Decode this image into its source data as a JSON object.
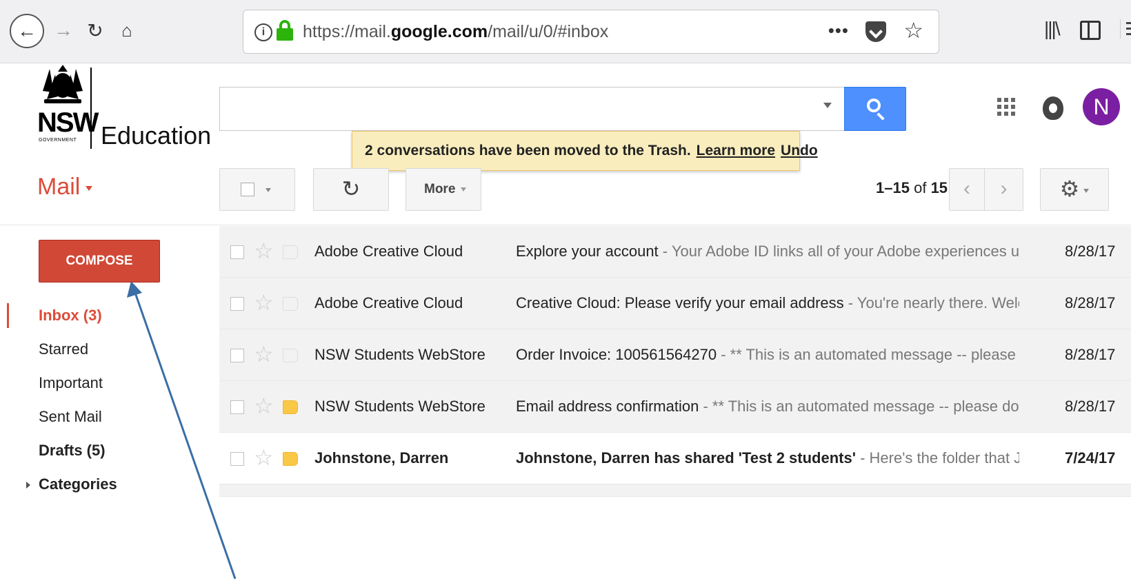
{
  "browser": {
    "url_prefix": "https://mail.",
    "url_domain": "google.com",
    "url_path": "/mail/u/0/#inbox",
    "url_more": "•••"
  },
  "brand": {
    "logo_word": "NSW",
    "logo_sub": "GOVERNMENT",
    "product": "Education"
  },
  "search": {
    "placeholder": ""
  },
  "account": {
    "initial": "N",
    "avatar_color": "#7b1fa2"
  },
  "toast": {
    "message": "2 conversations have been moved to the Trash.",
    "learn_more": "Learn more",
    "undo": "Undo"
  },
  "toolbar": {
    "mail_label": "Mail",
    "more_label": "More",
    "range": "1–15",
    "of_label": "of",
    "total": "15"
  },
  "compose_label": "COMPOSE",
  "nav": [
    {
      "label": "Inbox (3)",
      "state": "active"
    },
    {
      "label": "Starred",
      "state": ""
    },
    {
      "label": "Important",
      "state": ""
    },
    {
      "label": "Sent Mail",
      "state": ""
    },
    {
      "label": "Drafts (5)",
      "state": "bold"
    },
    {
      "label": "Categories",
      "state": "bold"
    }
  ],
  "emails": [
    {
      "sender": "Adobe Creative Cloud",
      "subject": "Explore your account",
      "snippet": " - Your Adobe ID links all of your Adobe experiences under one",
      "date": "8/28/17",
      "unread": false,
      "important": false
    },
    {
      "sender": "Adobe Creative Cloud",
      "subject": "Creative Cloud: Please verify your email address",
      "snippet": " - You're nearly there. Welcome to (",
      "date": "8/28/17",
      "unread": false,
      "important": false
    },
    {
      "sender": "NSW Students WebStore",
      "subject": "Order Invoice: 100561564270",
      "snippet": " - ** This is an automated message -- please do not re",
      "date": "8/28/17",
      "unread": false,
      "important": false
    },
    {
      "sender": "NSW Students WebStore",
      "subject": "Email address confirmation",
      "snippet": " - ** This is an automated message -- please do not reply",
      "date": "8/28/17",
      "unread": false,
      "important": true
    },
    {
      "sender": "Johnstone, Darren",
      "subject": "Johnstone, Darren has shared 'Test 2 students'",
      "snippet": " - Here's the folder that Johnstone",
      "date": "7/24/17",
      "unread": true,
      "important": true
    }
  ],
  "colors": {
    "accent_red": "#dd4b39",
    "compose_bg": "#d14836",
    "search_blue": "#4d90fe",
    "toast_bg": "#f9edbe",
    "important_tag": "#f9c846",
    "annotation_arrow": "#3a6ea5"
  }
}
